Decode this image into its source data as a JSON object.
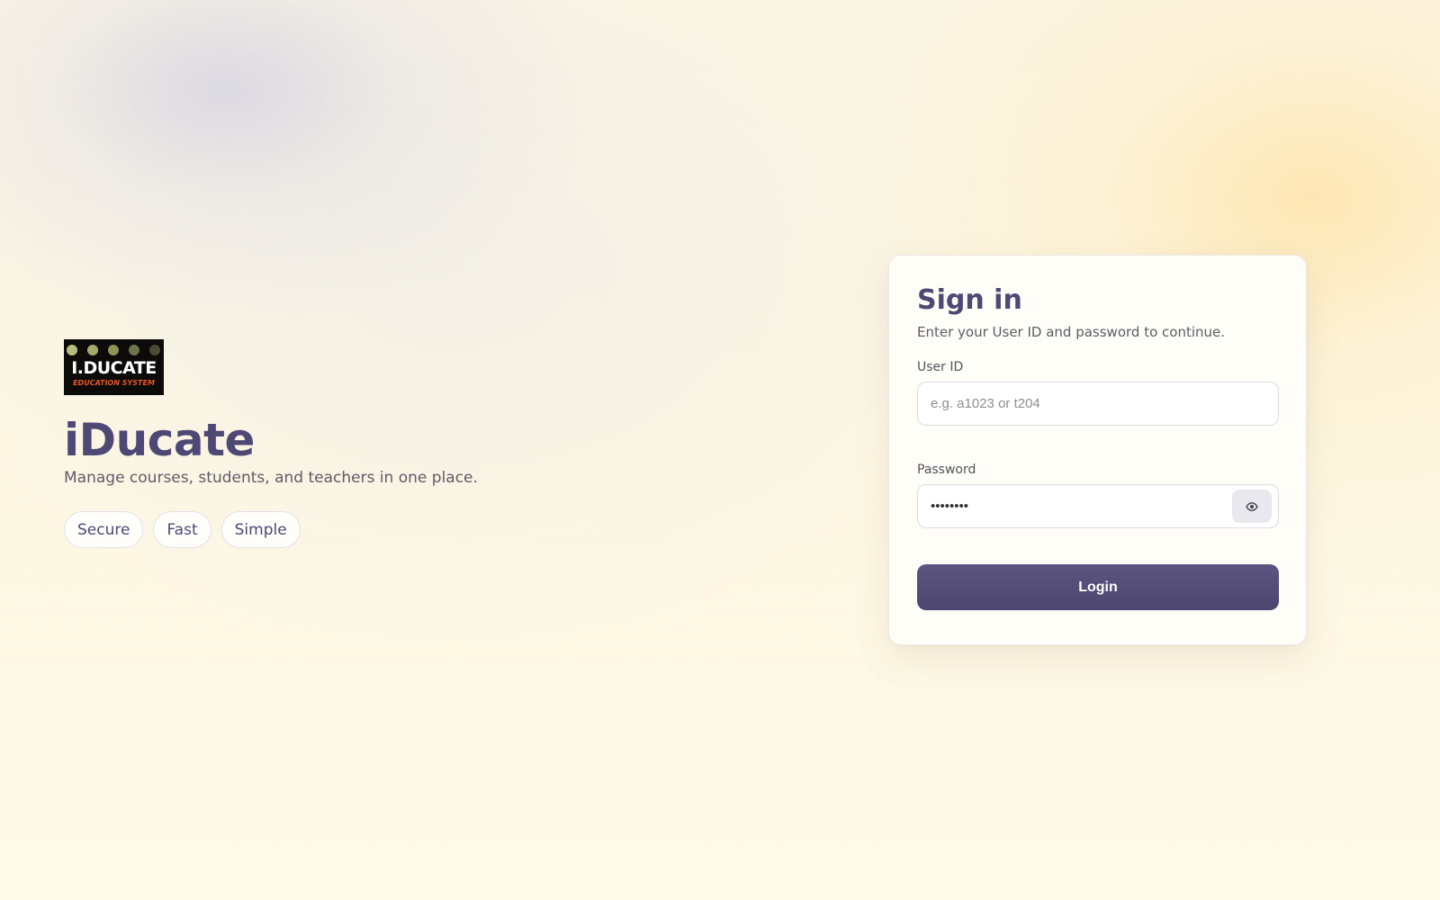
{
  "brand": {
    "logo_text": "I.DUCATE",
    "logo_subtext": "EDUCATION SYSTEM",
    "logo_dot_colors": [
      "#b9bd7c",
      "#a7ab6a",
      "#8f935a",
      "#6f7349",
      "#4a4d32"
    ],
    "title": "iDucate",
    "tagline": "Manage courses, students, and teachers in one place.",
    "features": [
      "Secure",
      "Fast",
      "Simple"
    ]
  },
  "signin": {
    "title": "Sign in",
    "subtitle": "Enter your User ID and password to continue.",
    "user_id_label": "User ID",
    "user_id_placeholder": "e.g. a1023 or t204",
    "user_id_value": "",
    "password_label": "Password",
    "password_value": "••••••••",
    "show_password_icon": "eye-icon",
    "login_label": "Login"
  },
  "colors": {
    "accent": "#4e4875",
    "button": "#5b557f",
    "background": "#fdf7e6"
  }
}
